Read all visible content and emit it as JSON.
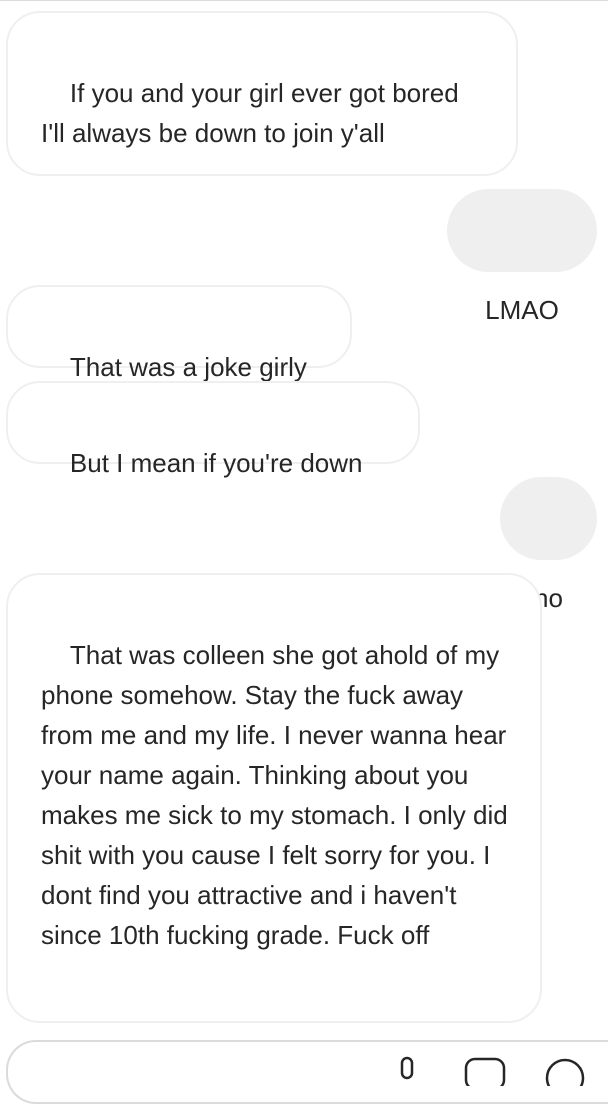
{
  "conversation": {
    "messages": [
      {
        "direction": "incoming",
        "text": "If you and your girl ever got bored I'll always be down to join y'all"
      },
      {
        "direction": "outgoing",
        "text": "LMAO"
      },
      {
        "direction": "incoming",
        "text": "That was a joke girly"
      },
      {
        "direction": "incoming",
        "text": "But I mean if you're down"
      },
      {
        "direction": "outgoing",
        "text": "no"
      },
      {
        "direction": "incoming",
        "text": "That was colleen she got ahold of my phone somehow. Stay the fuck away from me and my life. I never wanna hear your name again. Thinking about you makes me sick to my stomach. I only did shit with you cause I felt sorry for you. I dont find you attractive and i haven't since 10th fucking grade. Fuck off"
      }
    ]
  },
  "composer": {
    "icons": [
      "microphone-icon",
      "photo-icon",
      "sticker-icon"
    ]
  },
  "colors": {
    "incoming_bubble_border": "#efefef",
    "outgoing_bubble_background": "#efefef",
    "text": "#262626"
  }
}
